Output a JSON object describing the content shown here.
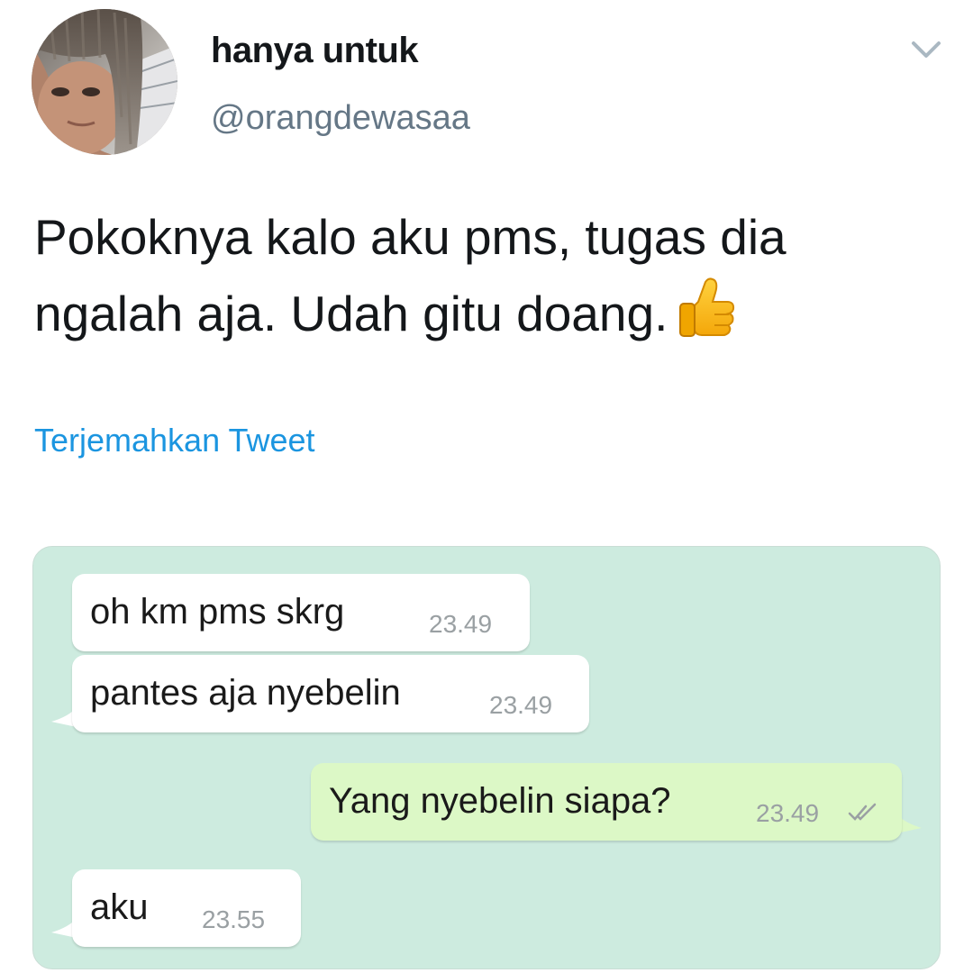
{
  "tweet": {
    "display_name": "hanya untuk",
    "handle": "@orangdewasaa",
    "text": "Pokoknya kalo aku pms, tugas dia ngalah aja. Udah gitu doang.",
    "emoji": "thumbs-up",
    "translate_label": "Terjemahkan Tweet"
  },
  "icons": {
    "menu": "chevron-down-icon",
    "avatar": "profile-photo",
    "read_receipt": "double-check-icon"
  },
  "chat": {
    "messages": [
      {
        "side": "incoming",
        "text": "oh km pms skrg",
        "time": "23.49"
      },
      {
        "side": "incoming",
        "text": "pantes aja nyebelin",
        "time": "23.49"
      },
      {
        "side": "outgoing",
        "text": "Yang nyebelin siapa?",
        "time": "23.49"
      },
      {
        "side": "incoming",
        "text": "aku",
        "time": "23.55"
      }
    ]
  },
  "colors": {
    "link": "#1b95e0",
    "handle": "#657786",
    "chat_background": "#cdebdf",
    "incoming_bubble": "#ffffff",
    "outgoing_bubble": "#dcf8c6"
  }
}
